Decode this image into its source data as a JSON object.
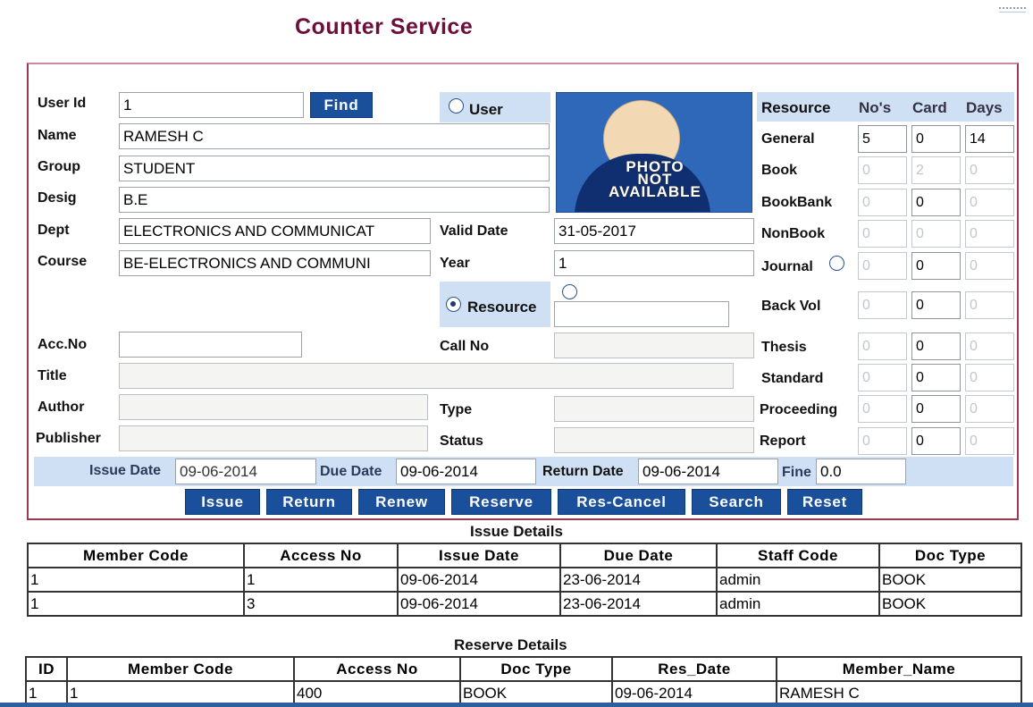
{
  "page_title": "Counter Service",
  "user": {
    "user_id_label": "User Id",
    "user_id": "1",
    "find_label": "Find",
    "name_label": "Name",
    "name": "RAMESH C",
    "group_label": "Group",
    "group": "STUDENT",
    "desig_label": "Desig",
    "desig": "B.E",
    "dept_label": "Dept",
    "dept": "ELECTRONICS AND COMMUNICAT",
    "course_label": "Course",
    "course": "BE-ELECTRONICS AND COMMUNI",
    "valid_date_label": "Valid Date",
    "valid_date": "31-05-2017",
    "year_label": "Year",
    "year": "1",
    "user_radio_label": "User"
  },
  "photo": {
    "line1": "PHOTO",
    "line2": "NOT",
    "line3": "AVAILABLE"
  },
  "resource_table": {
    "headers": [
      "Resource",
      "No's",
      "Card",
      "Days"
    ],
    "rows": [
      {
        "name": "General",
        "nos": "5",
        "card": "0",
        "days": "14"
      },
      {
        "name": "Book",
        "nos": "0",
        "card": "2",
        "days": "0"
      },
      {
        "name": "BookBank",
        "nos": "0",
        "card": "0",
        "days": "0"
      },
      {
        "name": "NonBook",
        "nos": "0",
        "card": "0",
        "days": "0"
      },
      {
        "name": "Journal",
        "nos": "0",
        "card": "0",
        "days": "0"
      },
      {
        "name": "Back Vol",
        "nos": "0",
        "card": "0",
        "days": "0"
      },
      {
        "name": "Thesis",
        "nos": "0",
        "card": "0",
        "days": "0"
      },
      {
        "name": "Standard",
        "nos": "0",
        "card": "0",
        "days": "0"
      },
      {
        "name": "Proceeding",
        "nos": "0",
        "card": "0",
        "days": "0"
      },
      {
        "name": "Report",
        "nos": "0",
        "card": "0",
        "days": "0"
      }
    ]
  },
  "resource": {
    "resource_radio_label": "Resource",
    "acc_no_label": "Acc.No",
    "acc_no": "",
    "call_no_label": "Call No",
    "call_no": "",
    "title_label": "Title",
    "title": "",
    "author_label": "Author",
    "author": "",
    "type_label": "Type",
    "type": "",
    "publisher_label": "Publisher",
    "publisher": "",
    "status_label": "Status",
    "status": ""
  },
  "dates": {
    "issue_date_label": "Issue Date",
    "issue_date": "09-06-2014",
    "due_date_label": "Due Date",
    "due_date": "09-06-2014",
    "return_date_label": "Return Date",
    "return_date": "09-06-2014",
    "fine_label": "Fine",
    "fine": "0.0"
  },
  "actions": [
    "Issue",
    "Return",
    "Renew",
    "Reserve",
    "Res-Cancel",
    "Search",
    "Reset"
  ],
  "issue_details": {
    "title": "Issue Details",
    "headers": [
      "Member Code",
      "Access No",
      "Issue Date",
      "Due Date",
      "Staff Code",
      "Doc Type"
    ],
    "rows": [
      [
        "1",
        "1",
        "09-06-2014",
        "23-06-2014",
        "admin",
        "BOOK"
      ],
      [
        "1",
        "3",
        "09-06-2014",
        "23-06-2014",
        "admin",
        "BOOK"
      ]
    ]
  },
  "reserve_details": {
    "title": "Reserve Details",
    "headers": [
      "ID",
      "Member Code",
      "Access No",
      "Doc Type",
      "Res_Date",
      "Member_Name"
    ],
    "rows": [
      [
        "1",
        "1",
        "400",
        "BOOK",
        "09-06-2014",
        "RAMESH C"
      ]
    ]
  },
  "colors": {
    "title": "#6b0f3c",
    "button": "#1a4f9c",
    "panel": "#cfe0f4",
    "frame": "#9a3b4e"
  }
}
